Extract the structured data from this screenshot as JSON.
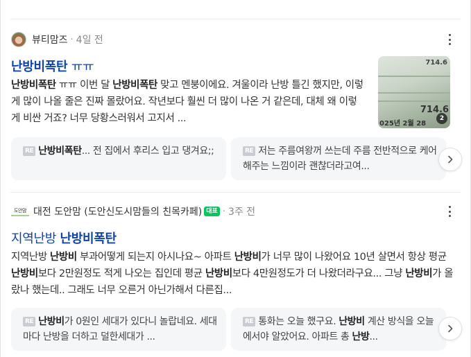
{
  "results": [
    {
      "author": "뷰티맘즈",
      "time": "4일 전",
      "title_bold": "난방비폭탄",
      "title_rest": " ㅠㅠ",
      "snippet": [
        {
          "t": "난방비폭탄",
          "b": true
        },
        {
          "t": " ㅠㅠ 이번 달 ",
          "b": false
        },
        {
          "t": "난방비폭탄",
          "b": true
        },
        {
          "t": " 맞고 멘붕이에요. 겨울이라 난방 틀긴 했지만, 이렇게 많이 나올 줄은 진짜 몰랐어요. 작년보다 훨씬 더 많이 나온 거 같은데, 대체 왜 이렇게 비싼 거죠? 너무 당황스러워서 고지서 ...",
          "b": false
        }
      ],
      "thumbnail": {
        "top_text": "714.6",
        "mid_text": "714.6",
        "bottom_text": "025년 2월 28",
        "count": "2"
      },
      "replies": [
        {
          "parts": [
            {
              "t": "난방비폭탄",
              "b": true
            },
            {
              "t": "... 전 집에서 후리스 입고 댕겨요;;",
              "b": false
            }
          ]
        },
        {
          "parts": [
            {
              "t": "저는 주름여왕꺼 쓰는데 주름 전반적으로 케어해주는 느낌이라 괜찮더라고여...",
              "b": false
            }
          ]
        }
      ]
    },
    {
      "author": "대전 도안맘 (도안신도시맘들의 친목카페)",
      "cafe_logo": "도안맘",
      "badge": "대표",
      "time": "3주 전",
      "title_rest": "지역난방 ",
      "title_bold": "난방비폭탄",
      "snippet": [
        {
          "t": "지역난방 ",
          "b": false
        },
        {
          "t": "난방비",
          "b": true
        },
        {
          "t": " 부과어떻게 되는지 아시나요~ 아파트 ",
          "b": false
        },
        {
          "t": "난방비",
          "b": true
        },
        {
          "t": "가 너무 많이 나왔어요 10년 살면서 항상 평균",
          "b": false
        },
        {
          "t": "난방비",
          "b": true
        },
        {
          "t": "보다 2만원정도 적게 나오는 집인데 평균 ",
          "b": false
        },
        {
          "t": "난방비",
          "b": true
        },
        {
          "t": "보다 4만원정도가 더 나왔더라구요... 그냥 ",
          "b": false
        },
        {
          "t": "난방비",
          "b": true
        },
        {
          "t": "가 올랐나 했는데.. 그래도 너무 오른거 아닌가해서 다른집...",
          "b": false
        }
      ],
      "replies": [
        {
          "parts": [
            {
              "t": "난방비",
              "b": true
            },
            {
              "t": "가 0원인 세대가 있다니 놀랍네요. 세대마다 난방을 더하고 덜한세대가 ...",
              "b": false
            }
          ]
        },
        {
          "parts": [
            {
              "t": "통화는 오늘 했구요. ",
              "b": false
            },
            {
              "t": "난방비",
              "b": true
            },
            {
              "t": " 계산 방식을 오늘에서야 알았어요. 아파트 총 ",
              "b": false
            },
            {
              "t": "난방",
              "b": true
            },
            {
              "t": "...",
              "b": false
            }
          ]
        }
      ]
    }
  ],
  "reply_label": "RE",
  "icons": {
    "more": "more-vertical-icon",
    "next": "chevron-right-icon"
  }
}
